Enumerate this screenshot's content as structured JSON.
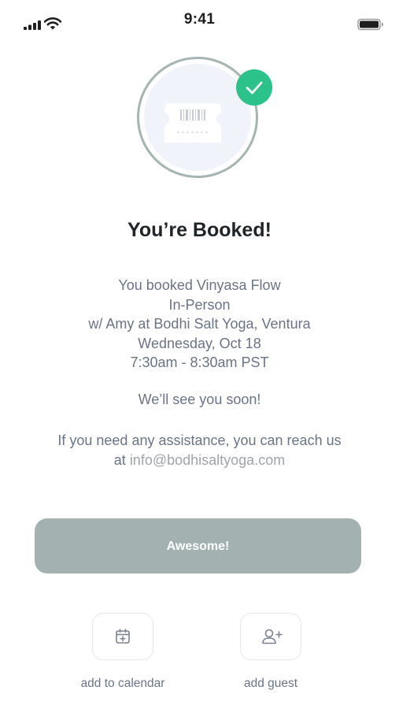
{
  "status_bar": {
    "time": "9:41",
    "icons": [
      "signal-icon",
      "wifi-icon",
      "battery-icon"
    ]
  },
  "hero": {
    "icons": [
      "ticket-icon",
      "checkmark-icon"
    ],
    "colors": {
      "ring": "#a5b5b2",
      "badge": "#2bc38a",
      "inner": "#f1f3fb"
    }
  },
  "title": "You’re Booked!",
  "details": {
    "line1": "You booked Vinyasa Flow",
    "line2": "In-Person",
    "line3": "w/ Amy at Bodhi Salt Yoga, Ventura",
    "line4": "Wednesday, Oct 18",
    "line5": "7:30am - 8:30am PST"
  },
  "see_you": "We’ll see you soon!",
  "assistance": {
    "line1": "If you need any assistance, you can reach us",
    "prefix": "at ",
    "email": "info@bodhisaltyoga.com"
  },
  "cta": {
    "label": "Awesome!",
    "color": "#a3b2b0"
  },
  "actions": {
    "calendar": {
      "label": "add to calendar",
      "icon": "calendar-add-icon"
    },
    "guest": {
      "label": "add guest",
      "icon": "user-add-icon"
    }
  },
  "colors": {
    "text_primary": "#1f2426",
    "text_secondary": "#6b7487",
    "link": "#a0a4ab"
  }
}
